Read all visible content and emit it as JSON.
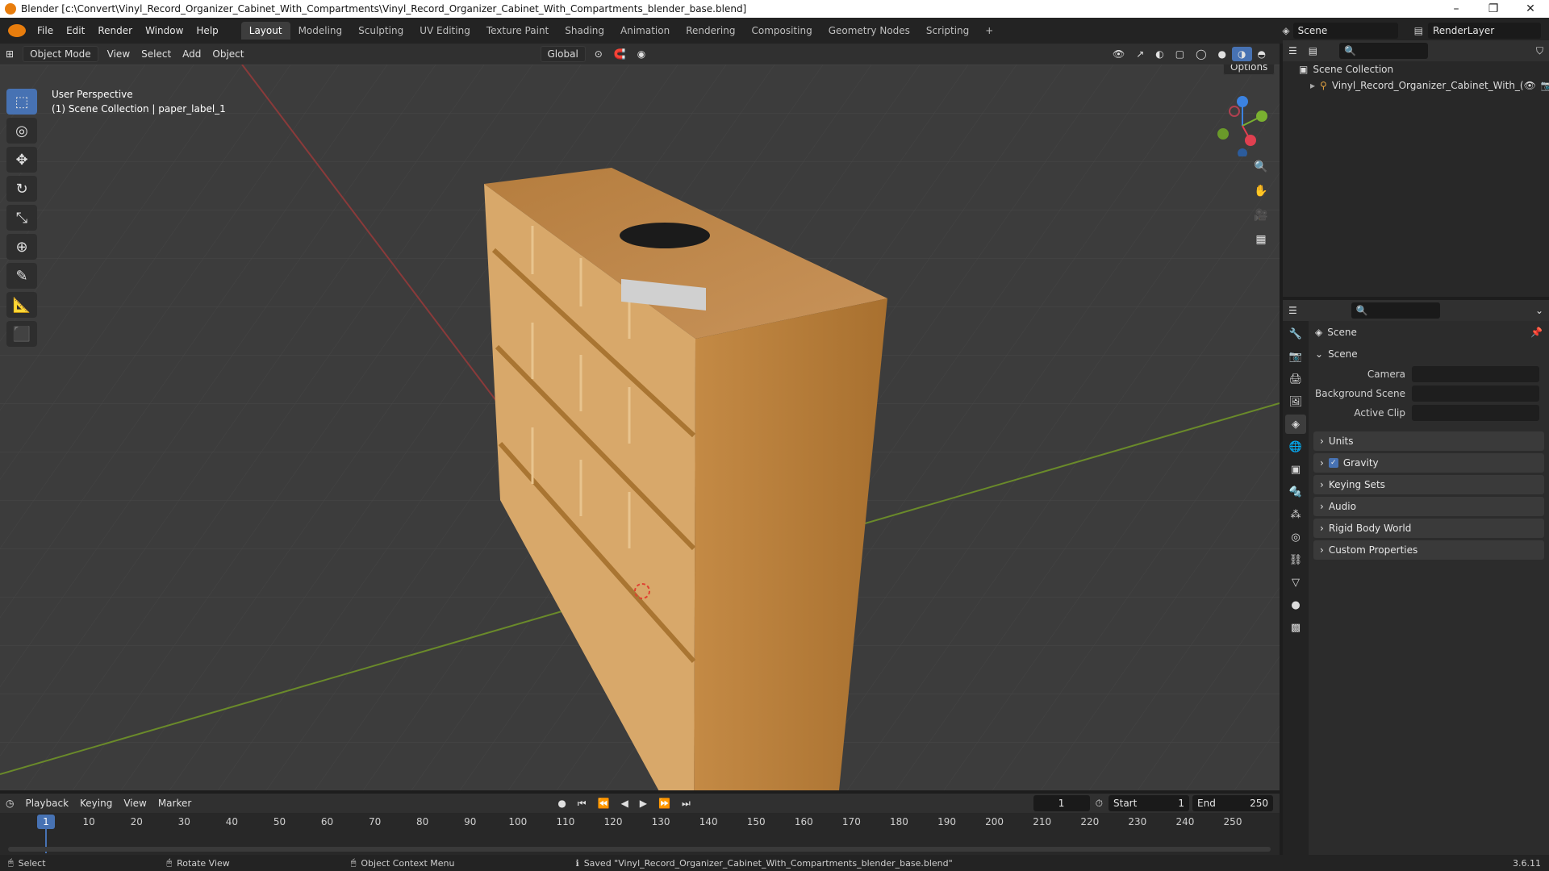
{
  "window": {
    "title": "Blender [c:\\Convert\\Vinyl_Record_Organizer_Cabinet_With_Compartments\\Vinyl_Record_Organizer_Cabinet_With_Compartments_blender_base.blend]",
    "minimize": "–",
    "maximize": "❐",
    "close": "✕"
  },
  "menu": [
    "File",
    "Edit",
    "Render",
    "Window",
    "Help"
  ],
  "workspaces": [
    {
      "label": "Layout",
      "active": true
    },
    {
      "label": "Modeling"
    },
    {
      "label": "Sculpting"
    },
    {
      "label": "UV Editing"
    },
    {
      "label": "Texture Paint"
    },
    {
      "label": "Shading"
    },
    {
      "label": "Animation"
    },
    {
      "label": "Rendering"
    },
    {
      "label": "Compositing"
    },
    {
      "label": "Geometry Nodes"
    },
    {
      "label": "Scripting"
    }
  ],
  "add_workspace": "+",
  "scene_field": "Scene",
  "renderlayer_field": "RenderLayer",
  "viewport_header": {
    "mode": "Object Mode",
    "menus": [
      "View",
      "Select",
      "Add",
      "Object"
    ],
    "transform_orientation": "Global",
    "options": "Options"
  },
  "viewport": {
    "perspective": "User Perspective",
    "collection_info": "(1) Scene Collection | paper_label_1",
    "gizmo_axes": [
      "Z",
      "Y",
      "X"
    ]
  },
  "tools": [
    {
      "name": "select-box-tool",
      "glyph": "⬚",
      "active": true
    },
    {
      "name": "cursor-tool",
      "glyph": "◎"
    },
    {
      "name": "move-tool",
      "glyph": "✥"
    },
    {
      "name": "rotate-tool",
      "glyph": "↻"
    },
    {
      "name": "scale-tool",
      "glyph": "⤡"
    },
    {
      "name": "transform-tool",
      "glyph": "⊕"
    },
    {
      "name": "annotate-tool",
      "glyph": "✎"
    },
    {
      "name": "measure-tool",
      "glyph": "📐"
    },
    {
      "name": "add-cube-tool",
      "glyph": "⬛"
    }
  ],
  "outliner": {
    "root": "Scene Collection",
    "item": "Vinyl_Record_Organizer_Cabinet_With_("
  },
  "properties": {
    "header_title": "Scene",
    "section": "Scene",
    "fields": [
      {
        "label": "Camera"
      },
      {
        "label": "Background Scene"
      },
      {
        "label": "Active Clip"
      }
    ],
    "panels": [
      {
        "label": "Units",
        "checkbox": false
      },
      {
        "label": "Gravity",
        "checkbox": true
      },
      {
        "label": "Keying Sets",
        "checkbox": false
      },
      {
        "label": "Audio",
        "checkbox": false
      },
      {
        "label": "Rigid Body World",
        "checkbox": false
      },
      {
        "label": "Custom Properties",
        "checkbox": false
      }
    ]
  },
  "timeline": {
    "menus": [
      "Playback",
      "Keying",
      "View",
      "Marker"
    ],
    "current_frame": "1",
    "start_label": "Start",
    "start": "1",
    "end_label": "End",
    "end": "250",
    "ticks": [
      "1",
      "10",
      "20",
      "30",
      "40",
      "50",
      "60",
      "70",
      "80",
      "90",
      "100",
      "110",
      "120",
      "130",
      "140",
      "150",
      "160",
      "170",
      "180",
      "190",
      "200",
      "210",
      "220",
      "230",
      "240",
      "250"
    ]
  },
  "status": {
    "select": "Select",
    "rotate": "Rotate View",
    "context": "Object Context Menu",
    "message": "Saved \"Vinyl_Record_Organizer_Cabinet_With_Compartments_blender_base.blend\"",
    "version": "3.6.11"
  },
  "colors": {
    "accent": "#4772b3",
    "wood": "#c8903f",
    "x_axis": "#e04050",
    "y_axis": "#7ab030",
    "z_axis": "#3b82e0"
  }
}
